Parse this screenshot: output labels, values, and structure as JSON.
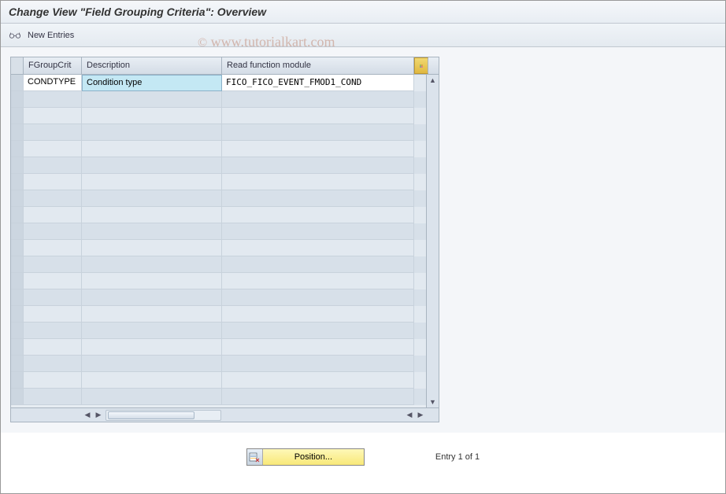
{
  "title": "Change View \"Field Grouping Criteria\": Overview",
  "toolbar": {
    "new_entries": "New Entries"
  },
  "watermark": "www.tutorialkart.com",
  "table": {
    "headers": {
      "fgroupcrit": "FGroupCrit",
      "description": "Description",
      "readfn": "Read function module"
    },
    "rows": [
      {
        "fgroupcrit": "CONDTYPE",
        "description": "Condition type",
        "readfn": "FICO_FICO_EVENT_FMOD1_COND"
      }
    ],
    "empty_rows": 19
  },
  "footer": {
    "position_label": "Position...",
    "entry_text": "Entry 1 of 1"
  }
}
